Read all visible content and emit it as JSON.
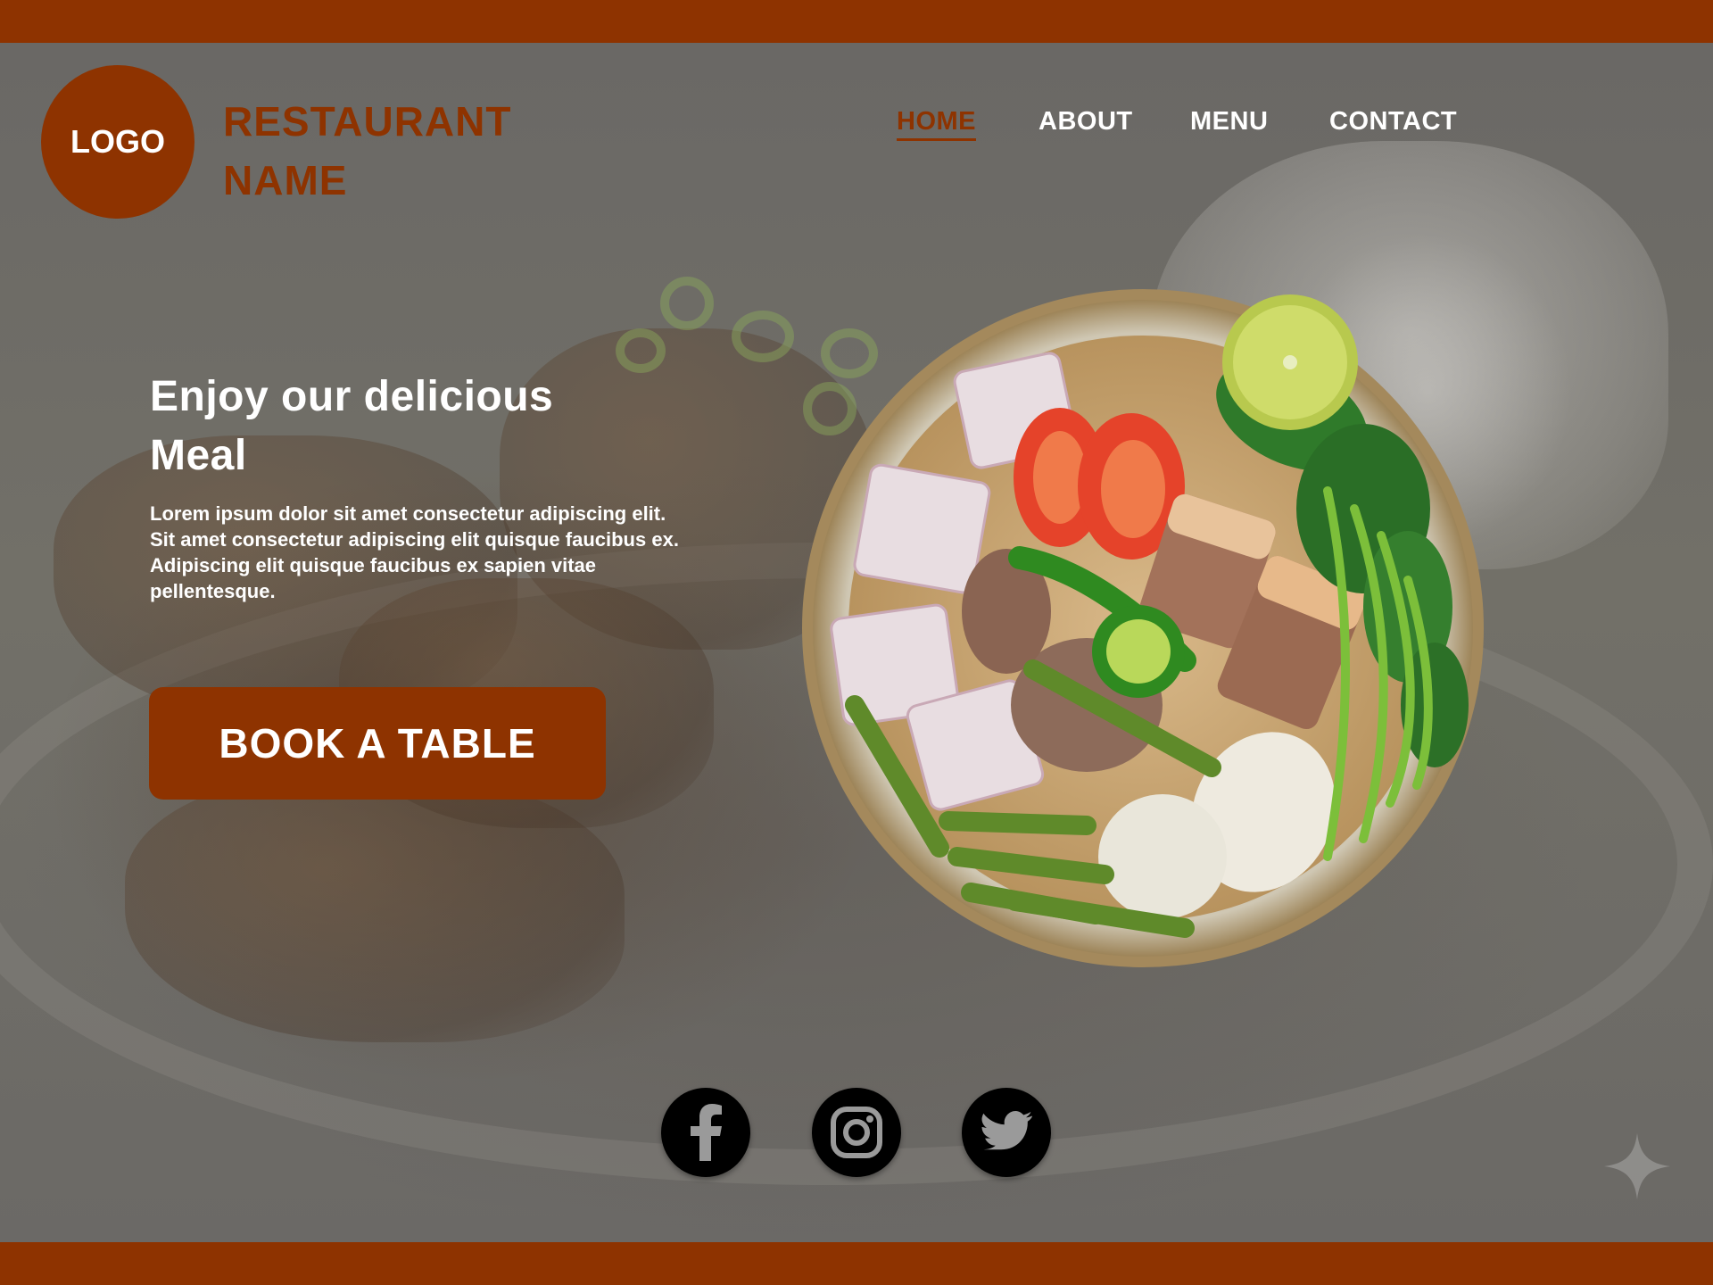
{
  "colors": {
    "brand": "#8e3300",
    "text_light": "#ffffff",
    "overlay": "#6f6d69",
    "social_bg": "#000000"
  },
  "header": {
    "logo_text": "LOGO",
    "brand_line1": "RESTAURANT",
    "brand_line2": "NAME",
    "nav": [
      {
        "label": "HOME",
        "active": true
      },
      {
        "label": "ABOUT",
        "active": false
      },
      {
        "label": "MENU",
        "active": false
      },
      {
        "label": "CONTACT",
        "active": false
      }
    ]
  },
  "hero": {
    "headline_line1": "Enjoy our delicious",
    "headline_line2": "Meal",
    "body": "Lorem ipsum dolor sit amet consectetur adipiscing elit. Sit amet consectetur adipiscing elit quisque faucibus ex. Adipiscing elit quisque faucibus ex sapien vitae pellentesque.",
    "cta_label": "BOOK A TABLE"
  },
  "images": {
    "background": "braised-pork-platter-photo",
    "featured": "sinigang-soup-bowl-photo"
  },
  "social": [
    {
      "icon": "facebook-icon"
    },
    {
      "icon": "instagram-icon"
    },
    {
      "icon": "twitter-icon"
    }
  ]
}
